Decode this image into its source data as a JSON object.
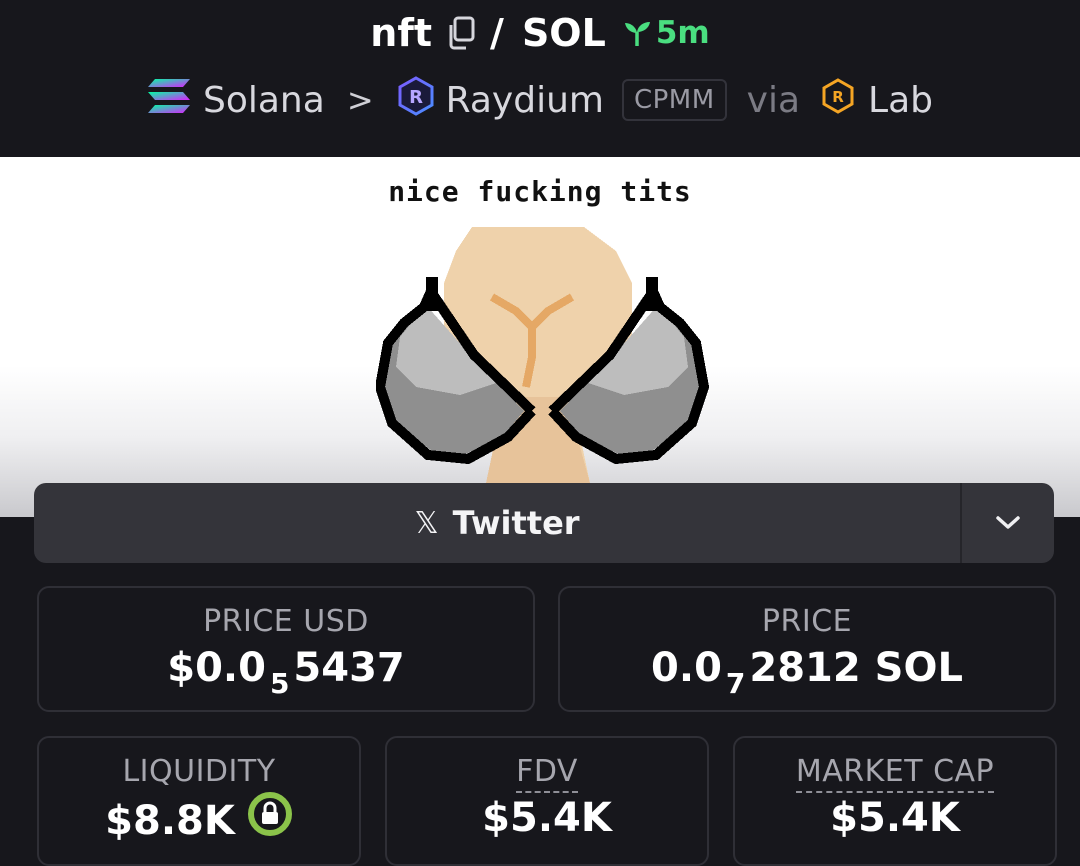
{
  "header": {
    "token_symbol": "nft",
    "pair_separator": "/",
    "quote_symbol": "SOL",
    "age": "5m",
    "chain": "Solana",
    "breadcrumb_sep": ">",
    "dex": "Raydium",
    "pool_type": "CPMM",
    "via": "via",
    "launchpad": "Lab"
  },
  "banner": {
    "caption": "nice fucking tits"
  },
  "socials": {
    "twitter_icon": "x-logo-icon",
    "twitter_label": "Twitter",
    "more_icon": "chevron-down-icon"
  },
  "stats": {
    "price_usd": {
      "label": "PRICE USD",
      "prefix": "$0.0",
      "zeros": "5",
      "digits": "5437"
    },
    "price_native": {
      "label": "PRICE",
      "prefix": "0.0",
      "zeros": "7",
      "digits": "2812 SOL"
    },
    "liquidity": {
      "label": "LIQUIDITY",
      "value": "$8.8K",
      "lock_icon": "lock-icon"
    },
    "fdv": {
      "label": "FDV",
      "value": "$5.4K"
    },
    "market_cap": {
      "label": "MARKET CAP",
      "value": "$5.4K"
    }
  },
  "colors": {
    "background": "#17171c",
    "age_green": "#4ade80",
    "lock_ring": "#8bc34a"
  }
}
